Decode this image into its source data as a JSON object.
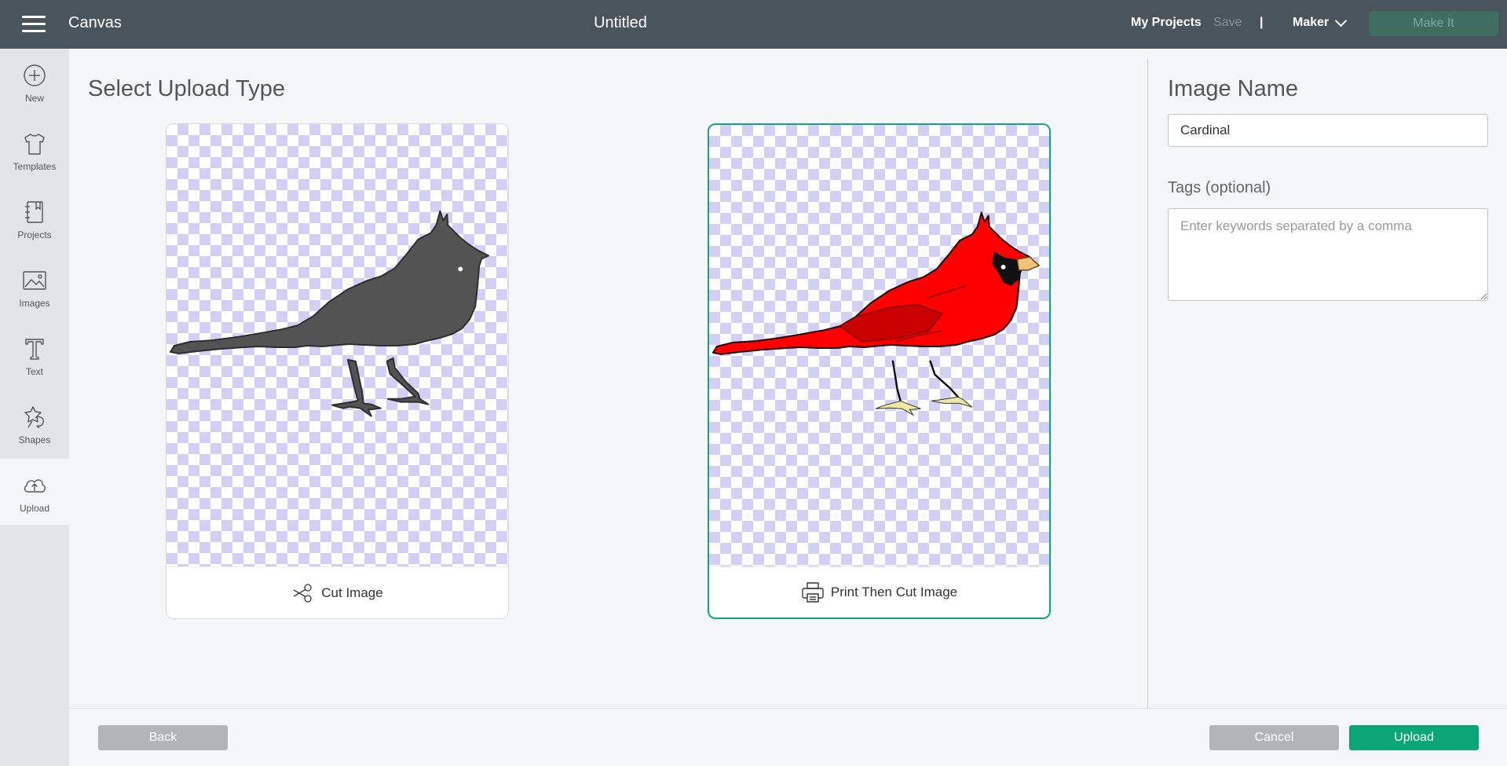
{
  "app": {
    "name": "Canvas",
    "document_title": "Untitled"
  },
  "topbar": {
    "my_projects": "My Projects",
    "save": "Save",
    "separator": "|",
    "machine": "Maker",
    "make_it": "Make It"
  },
  "sidebar": {
    "items": [
      {
        "label": "New",
        "icon": "plus-circle-icon"
      },
      {
        "label": "Templates",
        "icon": "tshirt-icon"
      },
      {
        "label": "Projects",
        "icon": "notebook-icon"
      },
      {
        "label": "Images",
        "icon": "image-icon"
      },
      {
        "label": "Text",
        "icon": "text-t-icon"
      },
      {
        "label": "Shapes",
        "icon": "shapes-icon"
      },
      {
        "label": "Upload",
        "icon": "cloud-upload-icon",
        "active": true
      }
    ]
  },
  "main": {
    "heading": "Select Upload Type",
    "options": [
      {
        "label": "Cut Image",
        "icon": "scissors-icon",
        "selected": false
      },
      {
        "label": "Print Then Cut Image",
        "icon": "printer-icon",
        "selected": true
      }
    ]
  },
  "panel": {
    "image_name_heading": "Image Name",
    "image_name_value": "Cardinal",
    "tags_label": "Tags (optional)",
    "tags_placeholder": "Enter keywords separated by a comma"
  },
  "footer": {
    "back": "Back",
    "cancel": "Cancel",
    "upload": "Upload"
  },
  "colors": {
    "topbar": "#4a545c",
    "accent": "#0aa676",
    "selected_border": "#11a67c",
    "checker": "#d2d0f4",
    "cardinal_red": "#ff0000"
  }
}
